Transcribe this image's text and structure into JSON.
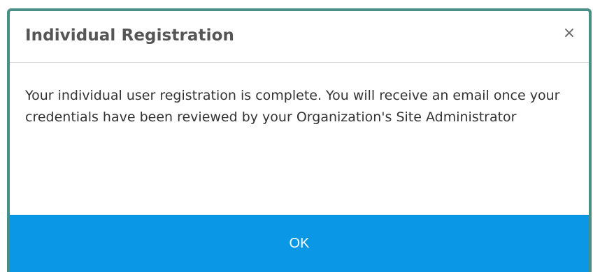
{
  "dialog": {
    "title": "Individual Registration",
    "close_label": "×",
    "message": "Your individual user registration is complete. You will receive an email once your credentials have been reviewed by your Organization's Site Administrator",
    "ok_label": "OK"
  },
  "colors": {
    "modal_border": "#4a8f86",
    "footer_background": "#0a98e6",
    "title_text": "#555555",
    "body_text": "#333333"
  },
  "icons": {
    "close": "close-icon"
  }
}
